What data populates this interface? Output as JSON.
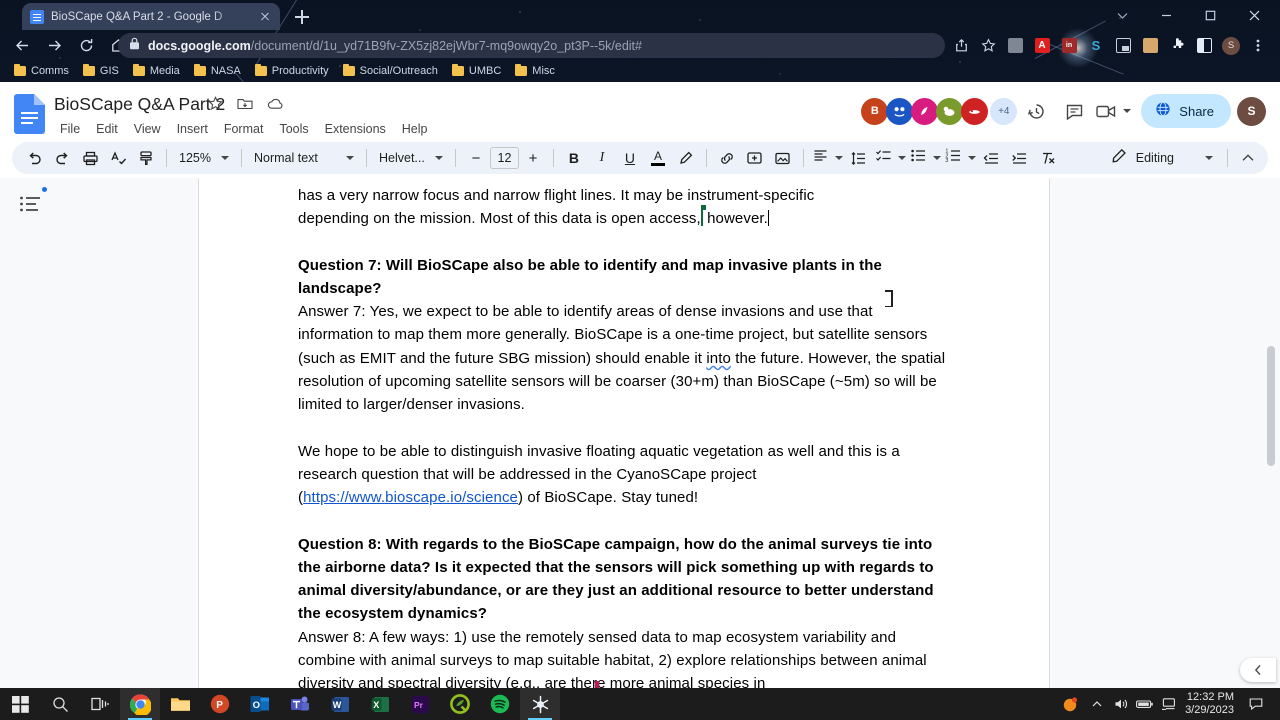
{
  "browser": {
    "tab": {
      "title": "BioSCape Q&A Part 2 - Google D",
      "favicon": "google-docs-favicon",
      "close": "×"
    },
    "newtab_label": "+",
    "window_controls": [
      "chevron-down-icon",
      "minimize-icon",
      "maximize-icon",
      "close-icon"
    ],
    "nav": {
      "back": "back-arrow-icon",
      "forward": "forward-arrow-icon",
      "reload": "reload-icon",
      "home": "home-icon"
    },
    "omnibox": {
      "lock": "lock-icon",
      "host": "docs.google.com",
      "path": "/document/d/1u_yd71B9fv-ZX5zj82ejWbr7-mq9owqy2o_pt3P--5k/edit#",
      "share_icon": "share-icon",
      "bookmark_icon": "star-icon"
    },
    "extensions": [
      {
        "name": "grey-extension-icon",
        "color": "#8a8f98",
        "letter": ""
      },
      {
        "name": "adobe-acrobat-icon",
        "color": "#e01f1f",
        "letter": "A"
      },
      {
        "name": "linkedin-extension-icon",
        "color": "#9e2a2a",
        "letter": "in"
      },
      {
        "name": "grammarly-icon",
        "color": "#15c39a",
        "letter": "S"
      },
      {
        "name": "picture-in-picture-icon",
        "color": "#c8cfdb",
        "letter": ""
      },
      {
        "name": "robot-extension-icon",
        "color": "#d7a86e",
        "letter": ""
      },
      {
        "name": "puzzle-extensions-icon",
        "color": "#ffffff",
        "letter": ""
      },
      {
        "name": "sidepanel-icon",
        "color": "#ffffff",
        "letter": ""
      },
      {
        "name": "profile-avatar",
        "color": "#6d4c41",
        "letter": "S"
      },
      {
        "name": "chrome-menu-icon",
        "color": "#cfd6e4",
        "letter": ""
      }
    ],
    "bookmarks": [
      {
        "label": "Comms"
      },
      {
        "label": "GIS"
      },
      {
        "label": "Media"
      },
      {
        "label": "NASA"
      },
      {
        "label": "Productivity"
      },
      {
        "label": "Social/Outreach"
      },
      {
        "label": "UMBC"
      },
      {
        "label": "Misc"
      }
    ]
  },
  "docs": {
    "title": "BioSCape Q&A Part 2",
    "title_icons": [
      "star-icon",
      "move-to-folder-icon",
      "cloud-saved-icon"
    ],
    "menus": [
      "File",
      "Edit",
      "View",
      "Insert",
      "Format",
      "Tools",
      "Extensions",
      "Help"
    ],
    "collaborators": [
      {
        "initial": "B",
        "color": "#c5421a"
      },
      {
        "initial": "",
        "color": "#1a56c4"
      },
      {
        "initial": "",
        "color": "#d81b7e"
      },
      {
        "initial": "",
        "color": "#7a9a2c"
      },
      {
        "initial": "",
        "color": "#cf2222"
      }
    ],
    "more_collaborators": "+4",
    "header_icons": [
      "version-history-icon",
      "comments-icon",
      "meet-camera-icon",
      "chevron-down-icon"
    ],
    "share": {
      "label": "Share",
      "icon": "globe-icon"
    },
    "account_avatar": {
      "initial": "S",
      "color": "#6d4c41"
    },
    "toolbar": {
      "undo": "undo-icon",
      "redo": "redo-icon",
      "print": "print-icon",
      "spellcheck": "spellcheck-icon",
      "paint_format": "paint-format-icon",
      "zoom": "125%",
      "style": "Normal text",
      "font": "Helvet...",
      "font_size_decrease": "−",
      "font_size": "12",
      "font_size_increase": "+",
      "bold": "B",
      "italic": "I",
      "underline": "U",
      "text_color": "A",
      "highlight": "highlight-pen-icon",
      "link": "link-icon",
      "comment": "add-comment-icon",
      "image": "insert-image-icon",
      "align": "align-left-icon",
      "line_spacing": "line-spacing-icon",
      "checklist": "checklist-icon",
      "bulleted_list": "bulleted-list-icon",
      "numbered_list": "numbered-list-icon",
      "decrease_indent": "decrease-indent-icon",
      "increase_indent": "increase-indent-icon",
      "clear_formatting": "clear-formatting-icon",
      "mode_label": "Editing",
      "mode_icon": "pencil-icon",
      "hide_menus": "chevron-up-icon"
    },
    "outline": {
      "icon": "document-outline-icon",
      "badge": "blue-dot"
    },
    "content": {
      "para_top_line1": "has a very narrow focus and narrow flight lines. It may be instrument-specific",
      "para_top_line2_a": "depending on the mission. Most of this data is open access,",
      "para_top_line2_b": " however.",
      "q7_heading": "Question 7: Will BioSCape also be able to identify and map invasive plants in the landscape?",
      "a7_part1": "Answer 7: Yes, we expect to be able to identify areas of dense invasions and use that information to map them more generally. BioSCape is a one-time project, but satellite sensors (such as EMIT and the future SBG mission) should enable it ",
      "a7_squiggle": "into",
      "a7_part2": " the future. However, the spatial resolution of upcoming satellite sensors will be coarser (30+m) than BioSCape (~5m) so will be limited to larger/denser invasions.",
      "p2_part1": "We hope to be able to distinguish invasive floating aquatic vegetation as well and this is a research question that will be addressed in the CyanoSCape project (",
      "p2_link": "https://www.bioscape.io/science",
      "p2_part2": ") of BioSCape. Stay tuned!",
      "q8_heading": "Question 8: With regards to the BioSCape campaign, how do the animal surveys tie into the airborne data? Is it expected that the sensors will pick something up with regards to animal diversity/abundance, or are they just an additional resource to better understand the ecosystem dynamics?",
      "a8_text": "Answer 8: A few ways: 1) use the remotely sensed data to map ecosystem variability and combine with animal surveys to map suitable habitat, 2) explore relationships between animal diversity and spectral diversity (e.g., are there more animal species in"
    },
    "collapse_panel_icon": "chevron-left-icon"
  },
  "taskbar": {
    "start": "windows-start-icon",
    "search": "search-icon",
    "task_view": "task-view-icon",
    "apps": [
      {
        "name": "google-chrome-icon",
        "active": true
      },
      {
        "name": "file-explorer-icon",
        "active": false
      },
      {
        "name": "powerpoint-icon",
        "active": false
      },
      {
        "name": "outlook-icon",
        "active": false
      },
      {
        "name": "microsoft-teams-icon",
        "active": false
      },
      {
        "name": "word-icon",
        "active": false
      },
      {
        "name": "excel-icon",
        "active": false
      },
      {
        "name": "premiere-pro-icon",
        "active": false
      },
      {
        "name": "qgis-icon",
        "active": false
      },
      {
        "name": "spotify-icon",
        "active": false
      },
      {
        "name": "snowflake-app-icon",
        "active": true
      }
    ],
    "tray": {
      "weather_icon": "sun-icon",
      "overflow": "chevron-up-icon",
      "volume": "volume-icon",
      "battery": "battery-icon",
      "network": "network-icon",
      "time": "12:32 PM",
      "date": "3/29/2023",
      "notifications": "notification-icon"
    }
  }
}
